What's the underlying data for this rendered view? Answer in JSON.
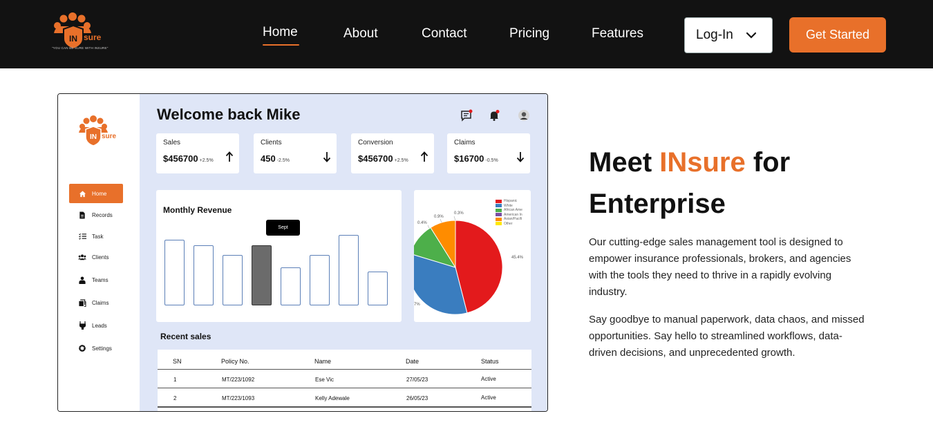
{
  "brand": {
    "name_prefix": "IN",
    "name_suffix": "sure",
    "tagline": "\"YOU CAN BE SURE WITH INSURE\"",
    "accent_color": "#e8702a",
    "nav_bg": "#121212"
  },
  "nav": {
    "links": [
      "Home",
      "About",
      "Contact",
      "Pricing",
      "Features"
    ],
    "active": "Home",
    "login_label": "Log-In",
    "cta_label": "Get Started"
  },
  "dashboard": {
    "welcome": "Welcome back Mike",
    "sidebar": {
      "items": [
        {
          "label": "Home",
          "icon": "home-icon"
        },
        {
          "label": "Records",
          "icon": "records-icon"
        },
        {
          "label": "Task",
          "icon": "task-icon"
        },
        {
          "label": "Clients",
          "icon": "clients-icon"
        },
        {
          "label": "Teams",
          "icon": "teams-icon"
        },
        {
          "label": "Claims",
          "icon": "claims-icon"
        },
        {
          "label": "Leads",
          "icon": "leads-icon"
        },
        {
          "label": "Settings",
          "icon": "settings-icon"
        }
      ]
    },
    "stats": [
      {
        "label": "Sales",
        "value": "$456700",
        "change": "+2.5%",
        "direction": "up"
      },
      {
        "label": "Clients",
        "value": "450",
        "change": "-2.5%",
        "direction": "down"
      },
      {
        "label": "Conversion",
        "value": "$456700",
        "change": "+2.5%",
        "direction": "up"
      },
      {
        "label": "Claims",
        "value": "$16700",
        "change": "-0.5%",
        "direction": "down"
      }
    ],
    "revenue": {
      "title": "Monthly Revenue",
      "tooltip": "Sept",
      "bar_levels": [
        0.52,
        0.48,
        0.4,
        0.48,
        0.3,
        0.4,
        0.56,
        0.27
      ],
      "selected_index": 3
    },
    "pie": {
      "legend": [
        {
          "label": "Hispanic",
          "color": "#e31a1c"
        },
        {
          "label": "White",
          "color": "#3a7dbf"
        },
        {
          "label": "African Ame",
          "color": "#4daf4a"
        },
        {
          "label": "American In",
          "color": "#7b4ea3"
        },
        {
          "label": "Asian/Pacifi",
          "color": "#ff8c00"
        },
        {
          "label": "Other",
          "color": "#ffe800"
        }
      ],
      "labels": [
        "45.4%",
        "0.9%",
        "0.3%",
        "0.4%",
        "7%"
      ]
    },
    "recent_sales": {
      "title": "Recent sales",
      "columns": [
        "SN",
        "Policy No.",
        "Name",
        "Date",
        "Status"
      ],
      "rows": [
        [
          "1",
          "MT/223/1092",
          "Ese Vic",
          "27/05/23",
          "Active"
        ],
        [
          "2",
          "MT/223/1093",
          "Kelly Adewale",
          "26/05/23",
          "Active"
        ]
      ]
    }
  },
  "hero": {
    "title_pre": "Meet ",
    "title_brand": "INsure",
    "title_post": " for",
    "title_line2": "Enterprise",
    "para1": "Our cutting-edge sales management tool is designed to empower insurance professionals, brokers, and agencies with the tools they need to thrive in a rapidly evolving industry.",
    "para2": "Say goodbye to manual paperwork, data chaos, and missed opportunities. Say hello to streamlined workflows, data-driven decisions, and unprecedented growth."
  }
}
